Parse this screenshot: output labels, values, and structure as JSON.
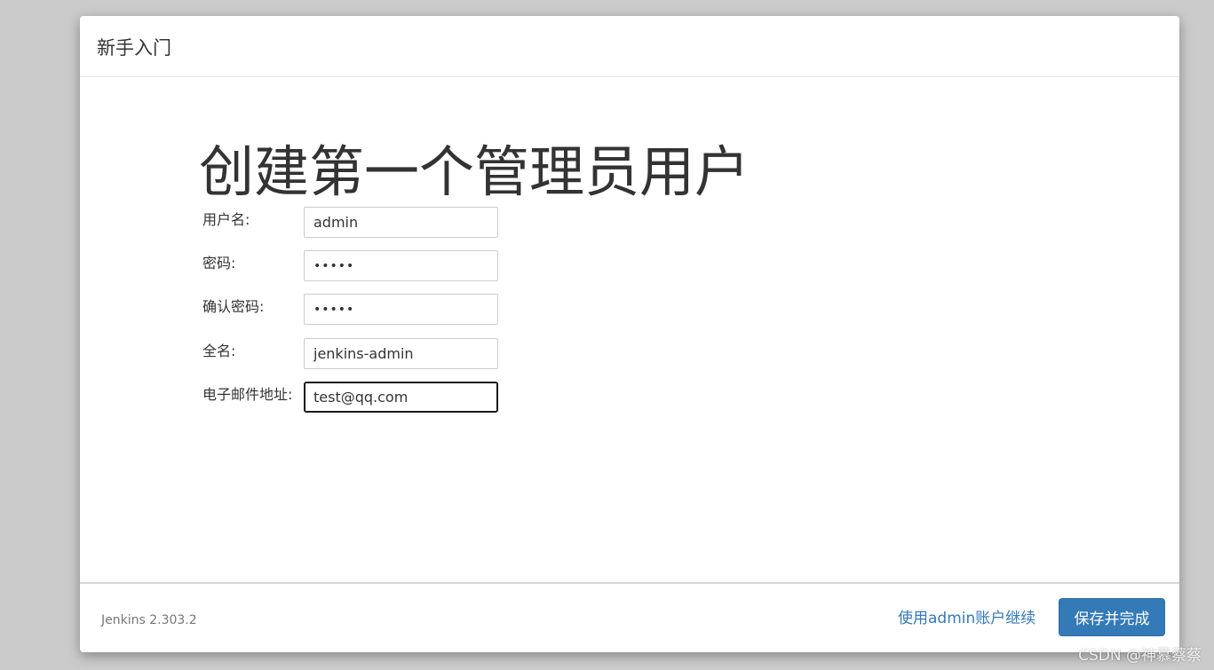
{
  "dialog": {
    "title": "新手入门"
  },
  "main": {
    "heading": "创建第一个管理员用户",
    "fields": [
      {
        "label": "用户名:",
        "value": "admin",
        "type": "text"
      },
      {
        "label": "密码:",
        "value": "•••••",
        "type": "password"
      },
      {
        "label": "确认密码:",
        "value": "•••••",
        "type": "password"
      },
      {
        "label": "全名:",
        "value": "jenkins-admin",
        "type": "text"
      },
      {
        "label": "电子邮件地址:",
        "value": "test@qq.com",
        "type": "email"
      }
    ]
  },
  "footer": {
    "version": "Jenkins 2.303.2",
    "continue_link": "使用admin账户继续",
    "save_button": "保存并完成"
  },
  "watermark": "CSDN @神慕蔡蔡",
  "colors": {
    "accent": "#337ab7",
    "background": "#cbcbcb"
  }
}
